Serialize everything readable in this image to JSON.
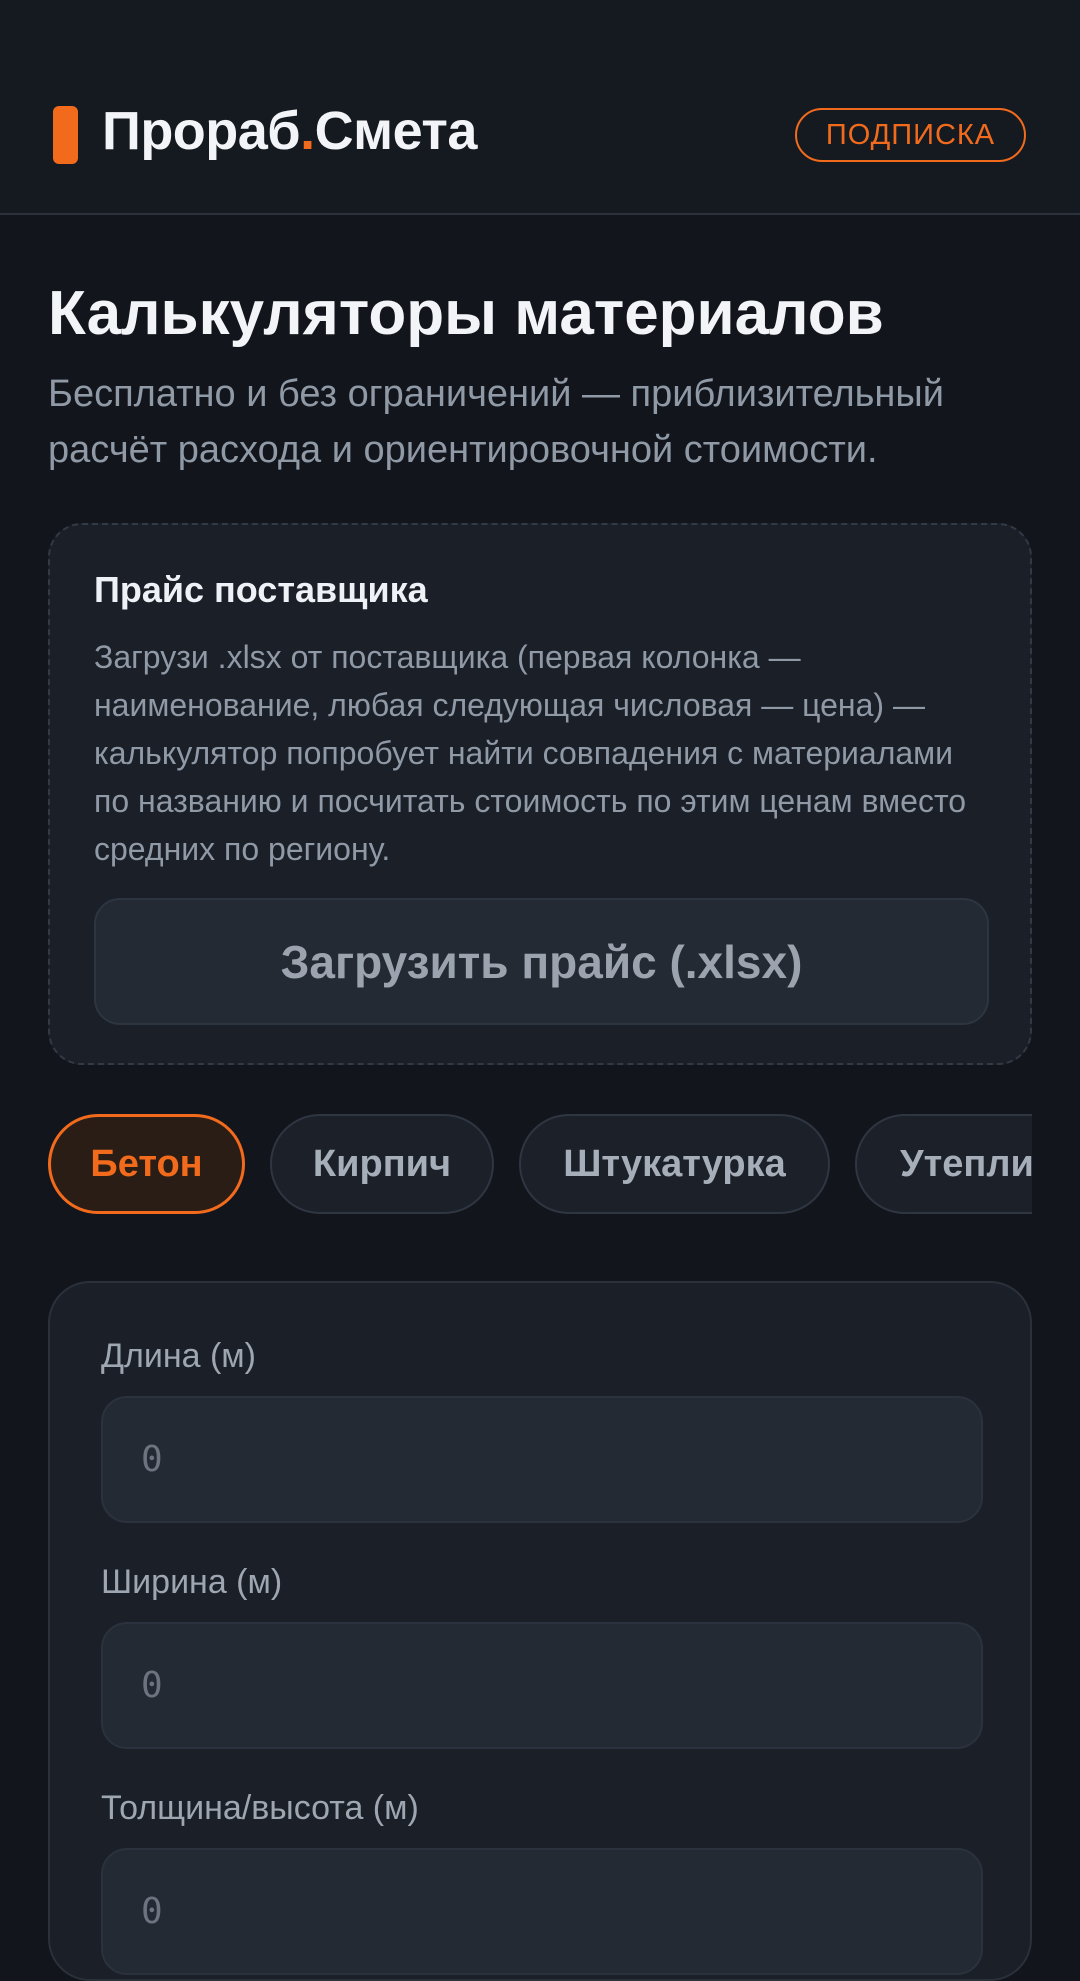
{
  "header": {
    "logo_part1": "Прораб",
    "logo_dot": ".",
    "logo_part2": "Смета",
    "subscription_label": "ПОДПИСКА"
  },
  "page": {
    "title": "Калькуляторы материалов",
    "subtitle": "Бесплатно и без ограничений — приблизительный расчёт расхода и ориентировочной стоимости."
  },
  "price_card": {
    "title": "Прайс поставщика",
    "description": "Загрузи .xlsx от поставщика (первая колонка — наименование, любая следующая числовая — цена) — калькулятор попробует найти совпадения с материалами по названию и посчитать стоимость по этим ценам вместо средних по региону.",
    "upload_label": "Загрузить прайс (.xlsx)"
  },
  "tabs": [
    {
      "label": "Бетон",
      "active": true
    },
    {
      "label": "Кирпич",
      "active": false
    },
    {
      "label": "Штукатурка",
      "active": false
    },
    {
      "label": "Утеплит",
      "active": false
    }
  ],
  "form": {
    "fields": [
      {
        "label": "Длина (м)",
        "placeholder": "0"
      },
      {
        "label": "Ширина (м)",
        "placeholder": "0"
      },
      {
        "label": "Толщина/высота (м)",
        "placeholder": "0"
      }
    ]
  },
  "colors": {
    "accent": "#f26b1d",
    "background": "#12161c",
    "card": "#1a1f28"
  }
}
